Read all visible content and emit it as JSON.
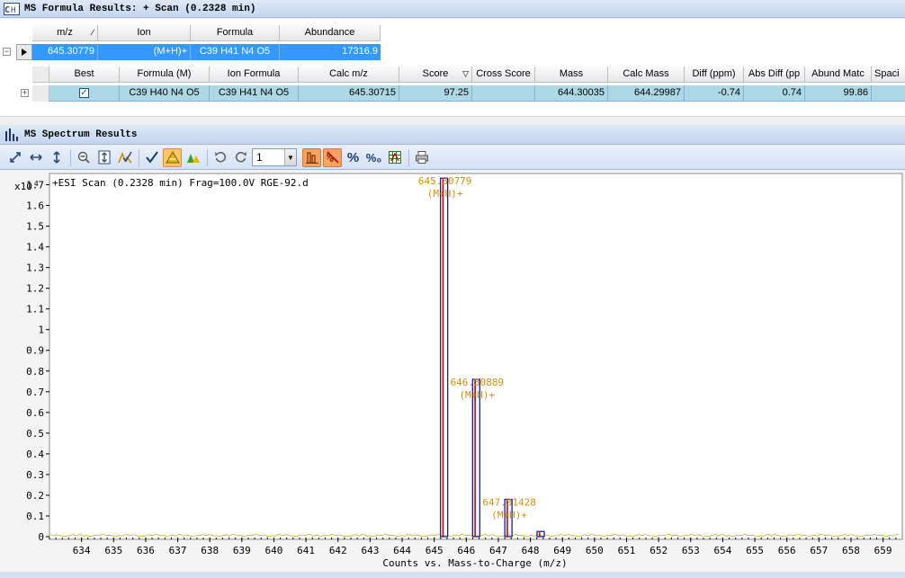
{
  "formula_pane": {
    "title": "MS Formula Results: + Scan (0.2328 min)",
    "icon": "formula-grid-icon",
    "columns": [
      {
        "label": "m/z",
        "sort": "⁄"
      },
      {
        "label": "Ion"
      },
      {
        "label": "Formula"
      },
      {
        "label": "Abundance"
      }
    ],
    "row": {
      "mz": "645.30779",
      "ion": "(M+H)+",
      "formula": "C39 H41 N4 O5",
      "abundance": "17316.9"
    },
    "sub_columns": [
      {
        "label": "Best"
      },
      {
        "label": "Formula (M)"
      },
      {
        "label": "Ion Formula"
      },
      {
        "label": "Calc m/z"
      },
      {
        "label": "Score",
        "sort": "▽"
      },
      {
        "label": "Cross Score"
      },
      {
        "label": "Mass"
      },
      {
        "label": "Calc Mass"
      },
      {
        "label": "Diff (ppm)"
      },
      {
        "label": "Abs Diff (pp"
      },
      {
        "label": "Abund Matc"
      },
      {
        "label": "Spaci"
      }
    ],
    "sub_row": {
      "best": "✓",
      "formula_m": "C39 H40 N4 O5",
      "ion_formula": "C39 H41 N4 O5",
      "calc_mz": "645.30715",
      "score": "97.25",
      "cross_score": "",
      "mass": "644.30035",
      "calc_mass": "644.29987",
      "diff_ppm": "-0.74",
      "abs_diff": "0.74",
      "abund_match": "99.86",
      "spacing": ""
    }
  },
  "spectrum_pane": {
    "title": "MS Spectrum Results",
    "icon": "spectrum-bars-icon",
    "toolbar": {
      "spin_value": "1",
      "percent_label": "%",
      "percent2_label": "%₀"
    }
  },
  "chart_data": {
    "type": "bar",
    "title": "+ESI Scan (0.2328 min) Frag=100.0V RGE-92.d",
    "xlabel": "Counts vs. Mass-to-Charge (m/z)",
    "y_multiplier": "x10",
    "y_exponent": "4",
    "xlim": [
      633,
      659.6
    ],
    "ylim": [
      0,
      1.75
    ],
    "x_ticks": [
      634,
      635,
      636,
      637,
      638,
      639,
      640,
      641,
      642,
      643,
      644,
      645,
      646,
      647,
      648,
      649,
      650,
      651,
      652,
      653,
      654,
      655,
      656,
      657,
      658,
      659
    ],
    "y_ticks": [
      0,
      0.1,
      0.2,
      0.3,
      0.4,
      0.5,
      0.6,
      0.7,
      0.8,
      0.9,
      1,
      1.1,
      1.2,
      1.3,
      1.4,
      1.5,
      1.6,
      1.7
    ],
    "y_tick_labels": [
      "0",
      "0.1",
      "0.2",
      "0.3",
      "0.4",
      "0.5",
      "0.6",
      "0.7",
      "0.8",
      "0.9",
      "1",
      "1.1",
      "1.2",
      "1.3",
      "1.4",
      "1.5",
      "1.6",
      "1.7"
    ],
    "peaks": [
      {
        "mz": 645.308,
        "value": 1.7317,
        "label": "645.30779",
        "ion": "(M+H)+"
      },
      {
        "mz": 646.309,
        "value": 0.76,
        "label": "646.30889",
        "ion": "(M+H)+"
      },
      {
        "mz": 647.314,
        "value": 0.18,
        "label": "647.31428",
        "ion": "(M+H)+"
      },
      {
        "mz": 648.32,
        "value": 0.025,
        "label": "",
        "ion": ""
      }
    ],
    "colors": {
      "peak": "#cc0000",
      "predicted_box": "#1a1aa0",
      "label": "#d4900a",
      "noise": "#b8b820"
    }
  }
}
